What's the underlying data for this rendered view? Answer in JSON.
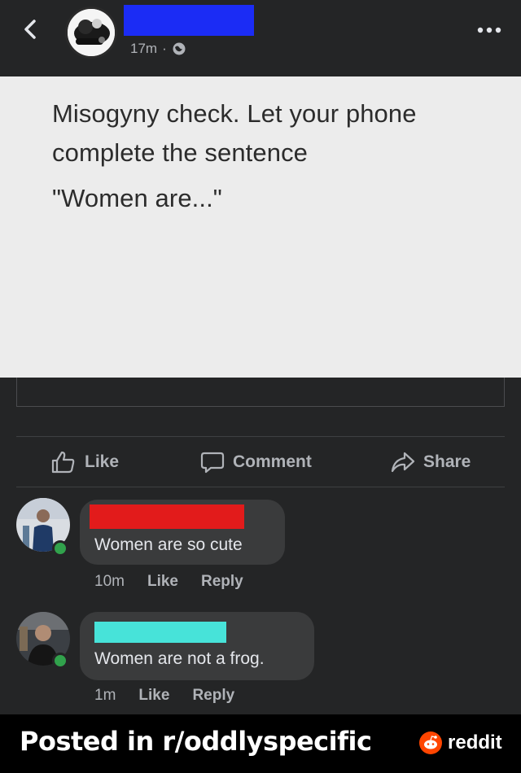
{
  "header": {
    "back_icon": "chevron-left-icon",
    "time": "17m",
    "separator": "·",
    "privacy_icon": "globe-icon",
    "more_icon": "more-dots-icon",
    "redaction_color": "#1b2cf5"
  },
  "post": {
    "lines": [
      "Misogyny check. Let your phone",
      "complete the sentence"
    ],
    "quote": "\"Women are...\""
  },
  "actions": {
    "like": "Like",
    "comment": "Comment",
    "share": "Share"
  },
  "comments": [
    {
      "redaction_color": "#e21b1b",
      "text": "Women are so cute",
      "time": "10m",
      "like": "Like",
      "reply": "Reply"
    },
    {
      "redaction_color": "#47e3d9",
      "text": "Women are not a frog.",
      "time": "1m",
      "like": "Like",
      "reply": "Reply"
    }
  ],
  "footer": {
    "posted_in": "Posted in r/oddlyspecific",
    "brand": "reddit",
    "brand_icon": "reddit-snoo-icon"
  }
}
